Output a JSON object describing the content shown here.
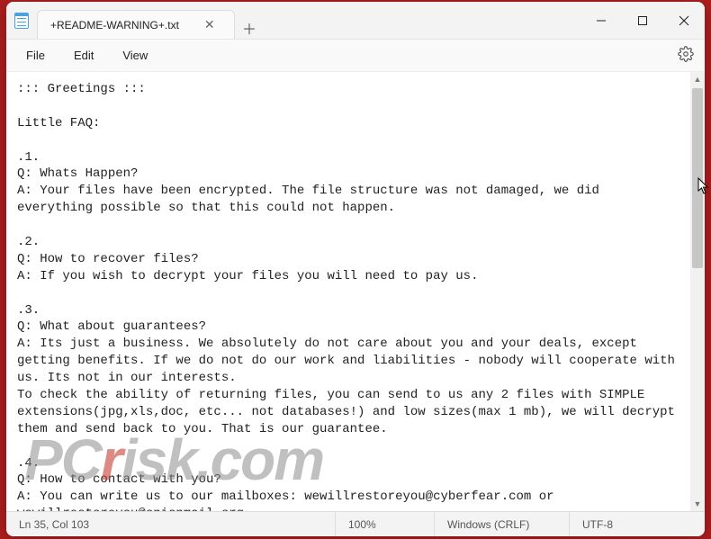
{
  "tab": {
    "title": "+README-WARNING+.txt"
  },
  "menu": {
    "file": "File",
    "edit": "Edit",
    "view": "View"
  },
  "content": "::: Greetings :::\n\nLittle FAQ:\n\n.1.\nQ: Whats Happen?\nA: Your files have been encrypted. The file structure was not damaged, we did everything possible so that this could not happen.\n\n.2.\nQ: How to recover files?\nA: If you wish to decrypt your files you will need to pay us.\n\n.3.\nQ: What about guarantees?\nA: Its just a business. We absolutely do not care about you and your deals, except getting benefits. If we do not do our work and liabilities - nobody will cooperate with us. Its not in our interests.\nTo check the ability of returning files, you can send to us any 2 files with SIMPLE extensions(jpg,xls,doc, etc... not databases!) and low sizes(max 1 mb), we will decrypt them and send back to you. That is our guarantee.\n\n.4.\nQ: How to contact with you?\nA: You can write us to our mailboxes: wewillrestoreyou@cyberfear.com or wewillrestoreyou@onionmail.org",
  "status": {
    "pos": "Ln 35, Col 103",
    "zoom": "100%",
    "lineend": "Windows (CRLF)",
    "encoding": "UTF-8"
  },
  "watermark": {
    "p": "P",
    "c": "C",
    "r": "r",
    "isk": "isk",
    "com": ".com"
  }
}
